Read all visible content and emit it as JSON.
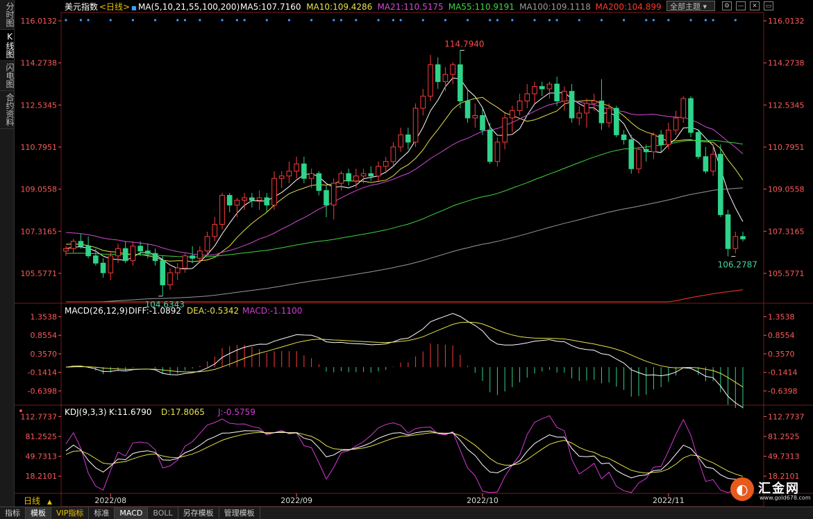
{
  "sidebar": {
    "tabs": [
      {
        "label": "分时图",
        "active": false
      },
      {
        "label": "K线图",
        "active": true
      },
      {
        "label": "闪电图",
        "active": false
      },
      {
        "label": "合约资料",
        "active": false
      }
    ]
  },
  "header": {
    "instrument": "美元指数",
    "period": "<日线>",
    "ma_params": "MA(5,10,21,55,100,200)",
    "ma_values": [
      {
        "label": "MA5:107.7160",
        "color": "#ffffff"
      },
      {
        "label": "MA10:109.4286",
        "color": "#e8e24a"
      },
      {
        "label": "MA21:110.5175",
        "color": "#d64ad6"
      },
      {
        "label": "MA55:110.9191",
        "color": "#3fd63f"
      },
      {
        "label": "MA100:109.1118",
        "color": "#9a9a9a"
      },
      {
        "label": "MA200:104.899",
        "color": "#ff3a2a"
      }
    ],
    "theme_select": "全部主题"
  },
  "macd_header": {
    "title": "MACD(26,12,9)",
    "diff": "DIFF:-1.0892",
    "dea": "DEA:-0.5342",
    "macd": "MACD:-1.1100"
  },
  "kdj_header": {
    "title": "KDJ(9,3,3)",
    "k": "K:11.6790",
    "d": "D:17.8065",
    "j": "J:-0.5759"
  },
  "period_label": "日线",
  "bottom_tabs": [
    "指标",
    "模板",
    "VIP指标",
    "标准",
    "MACD",
    "BOLL",
    "另存模板",
    "管理模板"
  ],
  "logo": {
    "name": "汇金网",
    "url": "www.gold678.com"
  },
  "colors": {
    "up": "#ff3b3b",
    "down": "#2fd38a",
    "ma5": "#ffffff",
    "ma10": "#e8e24a",
    "ma21": "#d64ad6",
    "ma55": "#3fd63f",
    "ma100": "#9a9a9a",
    "ma200": "#ff3a2a",
    "axis": "#ff5a5a"
  },
  "chart_data": [
    {
      "type": "candlestick",
      "title": "美元指数",
      "y_ticks": [
        "116.0132",
        "114.2738",
        "112.5345",
        "110.7951",
        "109.0558",
        "107.3165",
        "105.5771"
      ],
      "ylim": [
        104.4,
        116.3
      ],
      "x_ticks": [
        "2022/08",
        "2022/09",
        "2022/10",
        "2022/11"
      ],
      "x_tick_index": [
        6,
        31,
        56,
        81
      ],
      "annotations": [
        {
          "label": "114.7940",
          "index": 53,
          "value": 114.794,
          "kind": "high"
        },
        {
          "label": "104.6343",
          "index": 13,
          "value": 104.6343,
          "kind": "low"
        },
        {
          "label": "106.2787",
          "index": 90,
          "value": 106.2787,
          "kind": "low"
        }
      ],
      "ohlc": [
        [
          106.5,
          106.7,
          106.3,
          106.6
        ],
        [
          106.6,
          107.0,
          106.4,
          106.9
        ],
        [
          106.9,
          107.2,
          106.6,
          106.7
        ],
        [
          106.7,
          107.1,
          106.2,
          106.3
        ],
        [
          106.3,
          106.6,
          105.9,
          106.0
        ],
        [
          106.0,
          106.2,
          105.4,
          105.6
        ],
        [
          105.6,
          106.5,
          105.3,
          106.3
        ],
        [
          106.3,
          106.8,
          106.0,
          106.6
        ],
        [
          106.6,
          106.9,
          106.0,
          106.1
        ],
        [
          106.1,
          106.9,
          105.9,
          106.7
        ],
        [
          106.7,
          106.9,
          106.3,
          106.5
        ],
        [
          106.5,
          106.8,
          106.2,
          106.4
        ],
        [
          106.4,
          106.6,
          105.9,
          106.1
        ],
        [
          106.1,
          106.3,
          104.6343,
          105.1
        ],
        [
          105.1,
          105.8,
          104.9,
          105.6
        ],
        [
          105.6,
          106.0,
          105.3,
          105.8
        ],
        [
          105.8,
          106.4,
          105.6,
          106.3
        ],
        [
          106.3,
          106.7,
          106.0,
          106.2
        ],
        [
          106.2,
          106.7,
          106.0,
          106.5
        ],
        [
          106.5,
          107.3,
          106.3,
          107.1
        ],
        [
          107.1,
          107.9,
          106.9,
          107.6
        ],
        [
          107.6,
          108.9,
          107.4,
          108.8
        ],
        [
          108.8,
          108.9,
          108.1,
          108.4
        ],
        [
          108.4,
          108.7,
          107.9,
          108.6
        ],
        [
          108.6,
          108.9,
          108.2,
          108.7
        ],
        [
          108.7,
          108.9,
          108.3,
          108.6
        ],
        [
          108.6,
          109.0,
          108.2,
          108.7
        ],
        [
          108.7,
          108.9,
          108.1,
          108.4
        ],
        [
          108.4,
          109.8,
          108.2,
          109.5
        ],
        [
          109.5,
          109.8,
          109.1,
          109.6
        ],
        [
          109.6,
          110.2,
          109.3,
          109.8
        ],
        [
          109.8,
          110.4,
          109.5,
          110.1
        ],
        [
          110.1,
          110.4,
          109.3,
          109.5
        ],
        [
          109.5,
          109.9,
          109.1,
          109.7
        ],
        [
          109.7,
          109.8,
          108.8,
          109.0
        ],
        [
          109.0,
          109.2,
          107.9,
          108.4
        ],
        [
          108.4,
          109.5,
          107.8,
          109.3
        ],
        [
          109.3,
          109.8,
          109.0,
          109.7
        ],
        [
          109.7,
          109.9,
          109.2,
          109.4
        ],
        [
          109.4,
          109.9,
          109.1,
          109.6
        ],
        [
          109.6,
          109.9,
          109.3,
          109.7
        ],
        [
          109.7,
          110.0,
          109.4,
          109.6
        ],
        [
          109.6,
          110.2,
          109.4,
          110.0
        ],
        [
          110.0,
          110.4,
          109.7,
          110.2
        ],
        [
          110.2,
          111.0,
          110.0,
          110.8
        ],
        [
          110.8,
          111.6,
          110.6,
          111.3
        ],
        [
          111.3,
          111.6,
          110.7,
          111.0
        ],
        [
          111.0,
          112.6,
          110.8,
          112.4
        ],
        [
          112.4,
          113.2,
          112.1,
          112.9
        ],
        [
          112.9,
          114.6,
          112.7,
          114.2
        ],
        [
          114.2,
          114.5,
          113.2,
          113.5
        ],
        [
          113.5,
          114.1,
          113.1,
          113.8
        ],
        [
          113.8,
          114.3,
          113.4,
          114.2
        ],
        [
          114.2,
          114.794,
          112.4,
          112.7
        ],
        [
          112.7,
          113.2,
          111.8,
          112.0
        ],
        [
          112.0,
          112.6,
          111.6,
          112.1
        ],
        [
          112.1,
          112.4,
          111.3,
          111.5
        ],
        [
          111.5,
          111.8,
          110.1,
          110.2
        ],
        [
          110.2,
          111.2,
          110.0,
          111.0
        ],
        [
          111.0,
          112.2,
          110.7,
          112.0
        ],
        [
          112.0,
          112.5,
          111.4,
          112.3
        ],
        [
          112.3,
          113.0,
          112.1,
          112.7
        ],
        [
          112.7,
          113.4,
          112.4,
          113.0
        ],
        [
          113.0,
          113.5,
          112.6,
          113.3
        ],
        [
          113.3,
          113.5,
          112.9,
          113.2
        ],
        [
          113.2,
          113.5,
          112.8,
          113.4
        ],
        [
          113.4,
          113.7,
          112.5,
          112.7
        ],
        [
          112.7,
          113.3,
          112.3,
          113.1
        ],
        [
          113.1,
          113.4,
          111.8,
          112.0
        ],
        [
          112.0,
          112.5,
          111.7,
          112.2
        ],
        [
          112.2,
          112.8,
          111.6,
          112.6
        ],
        [
          112.6,
          113.0,
          112.3,
          112.7
        ],
        [
          112.7,
          113.6,
          111.5,
          111.8
        ],
        [
          111.8,
          112.6,
          111.6,
          112.4
        ],
        [
          112.4,
          112.5,
          111.2,
          111.3
        ],
        [
          111.3,
          111.5,
          110.9,
          111.1
        ],
        [
          111.1,
          111.3,
          109.7,
          109.9
        ],
        [
          109.9,
          110.8,
          109.7,
          110.7
        ],
        [
          110.7,
          110.9,
          110.2,
          110.6
        ],
        [
          110.6,
          111.4,
          110.3,
          111.3
        ],
        [
          111.3,
          111.5,
          110.6,
          110.9
        ],
        [
          110.9,
          111.8,
          110.7,
          111.5
        ],
        [
          111.5,
          112.3,
          111.3,
          112.0
        ],
        [
          112.0,
          112.9,
          111.8,
          112.8
        ],
        [
          112.8,
          112.9,
          111.2,
          111.4
        ],
        [
          111.4,
          111.5,
          110.3,
          110.4
        ],
        [
          110.4,
          110.8,
          109.7,
          109.8
        ],
        [
          109.8,
          110.9,
          109.6,
          110.5
        ],
        [
          110.5,
          110.9,
          107.9,
          108.0
        ],
        [
          108.0,
          108.2,
          106.2787,
          106.6
        ],
        [
          106.6,
          107.3,
          106.4,
          107.1
        ],
        [
          107.1,
          107.3,
          106.9,
          107.0
        ]
      ],
      "ma_ends": {
        "ma5": 107.716,
        "ma10": 109.4286,
        "ma21": 110.5175,
        "ma55": 110.9191,
        "ma100": 109.1118,
        "ma200": 104.899
      }
    },
    {
      "type": "macd",
      "title": "MACD(26,12,9)",
      "y_ticks": [
        "1.3538",
        "0.8554",
        "0.3570",
        "-0.1414",
        "-0.6398"
      ],
      "ylim": [
        -0.95,
        1.55
      ],
      "diff_end": -1.0892,
      "dea_end": -0.5342,
      "macd_end": -1.11
    },
    {
      "type": "kdj",
      "title": "KDJ(9,3,3)",
      "y_ticks": [
        "112.7737",
        "81.2525",
        "49.7313",
        "18.2101"
      ],
      "ylim": [
        -8,
        122
      ],
      "k_end": 11.679,
      "d_end": 17.8065,
      "j_end": -0.5759
    }
  ]
}
